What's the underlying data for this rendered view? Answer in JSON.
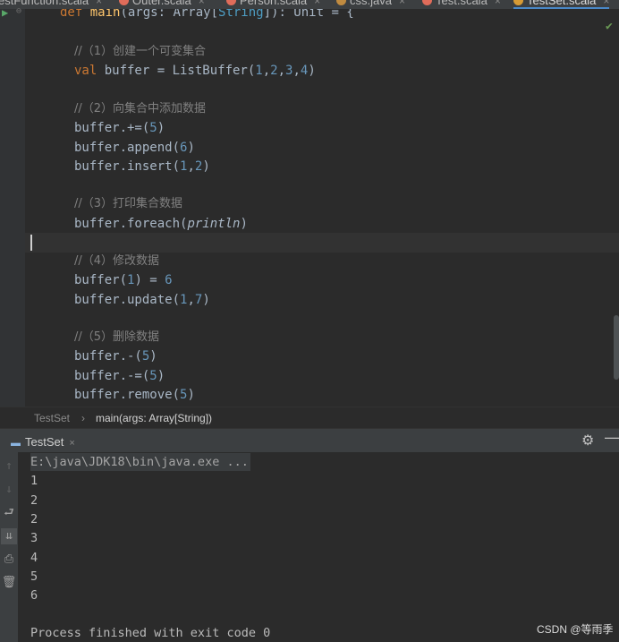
{
  "tabs": [
    {
      "label": "estFunction.scala",
      "dot": ""
    },
    {
      "label": "Outer.scala",
      "dot": "#e06c5a"
    },
    {
      "label": "Person.scala",
      "dot": "#e06c5a"
    },
    {
      "label": "css.java",
      "dot": "#c08b40"
    },
    {
      "label": "Test.scala",
      "dot": "#e06c5a"
    },
    {
      "label": "TestSet.scala",
      "dot": "#d79b35",
      "active": true
    }
  ],
  "code": {
    "l0": {
      "kw": "def ",
      "name": "main",
      "rest1": "(args: Array[",
      "type": "String",
      "rest2": "]): Unit = {"
    },
    "c1": "//（1）创建一个可变集合",
    "l1": {
      "kw": "val ",
      "rest": "buffer = ListBuffer(",
      "nums": [
        "1",
        "2",
        "3",
        "4"
      ],
      "end": ")"
    },
    "c2": "//（2）向集合中添加数据",
    "l2": {
      "a": "buffer.+=(",
      "n": "5",
      "b": ")"
    },
    "l3": {
      "a": "buffer.append(",
      "n": "6",
      "b": ")"
    },
    "l4": {
      "a": "buffer.insert(",
      "n1": "1",
      "mid": ",",
      "n2": "2",
      "b": ")"
    },
    "c3": "//（3）打印集合数据",
    "l5": {
      "a": "buffer.foreach(",
      "it": "println",
      "b": ")"
    },
    "c4": "//（4）修改数据",
    "l6": {
      "a": "buffer(",
      "n1": "1",
      "mid": ") = ",
      "n2": "6"
    },
    "l7": {
      "a": "buffer.update(",
      "n1": "1",
      "mid": ",",
      "n2": "7",
      "b": ")"
    },
    "c5": "//（5）删除数据",
    "l8": {
      "a": "buffer.-(",
      "n": "5",
      "b": ")"
    },
    "l9": {
      "a": "buffer.-=(",
      "n": "5",
      "b": ")"
    },
    "l10": {
      "a": "buffer.remove(",
      "n": "5",
      "b": ")"
    }
  },
  "breadcrumb": {
    "item1": "TestSet",
    "sep": "›",
    "item2": "main(args: Array[String])"
  },
  "run": {
    "tab_label": "TestSet",
    "close": "×"
  },
  "console": {
    "path": "E:\\java\\JDK18\\bin\\java.exe ...",
    "lines": [
      "1",
      "2",
      "2",
      "3",
      "4",
      "5",
      "6"
    ],
    "exit": "Process finished with exit code 0"
  },
  "icons": {
    "run": "run-gutter-icon",
    "settings": "gear-icon",
    "hide": "minimize-icon",
    "up": "arrow-up-icon",
    "down": "arrow-down-icon",
    "wrap": "soft-wrap-icon",
    "scroll_end": "scroll-to-end-icon",
    "print": "print-icon",
    "trash": "trash-icon"
  },
  "watermark": "CSDN @等雨季"
}
